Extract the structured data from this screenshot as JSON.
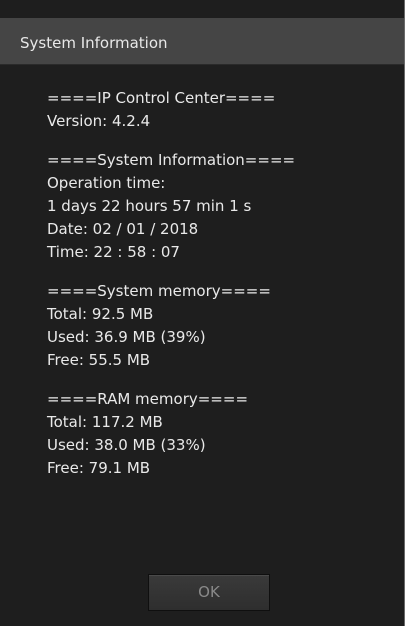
{
  "dialog": {
    "title": "System Information"
  },
  "sections": {
    "ip_control": {
      "header": "====IP Control Center====",
      "version": "Version: 4.2.4"
    },
    "system_info": {
      "header": "====System Information====",
      "operation_label": "Operation time:",
      "operation_time": "1 days 22 hours 57 min 1 s",
      "date": "Date: 02 / 01 / 2018",
      "time": "Time: 22 : 58 : 07"
    },
    "system_memory": {
      "header": "====System memory====",
      "total": "Total: 92.5 MB",
      "used": "Used: 36.9 MB (39%)",
      "free": "Free: 55.5 MB"
    },
    "ram_memory": {
      "header": "====RAM memory====",
      "total": "Total: 117.2 MB",
      "used": "Used: 38.0 MB (33%)",
      "free": "Free: 79.1 MB"
    }
  },
  "buttons": {
    "ok_label": "OK"
  },
  "colors": {
    "dialog_background": "#1e1e1e",
    "titlebar_background": "#454545",
    "text": "#e9e9e9",
    "button_text_disabled": "#8a8a8a"
  }
}
